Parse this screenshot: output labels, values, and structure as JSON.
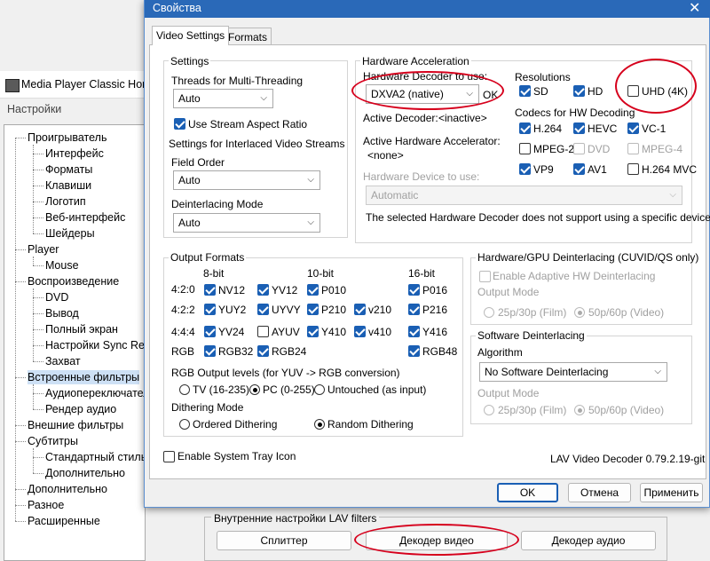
{
  "back_window": {
    "title": "Media Player Classic Hom",
    "subtitle": "Настройки",
    "tree": [
      {
        "label": "Проигрыватель",
        "level": 0
      },
      {
        "label": "Интерфейс",
        "level": 1
      },
      {
        "label": "Форматы",
        "level": 1
      },
      {
        "label": "Клавиши",
        "level": 1
      },
      {
        "label": "Логотип",
        "level": 1
      },
      {
        "label": "Веб-интерфейс",
        "level": 1
      },
      {
        "label": "Шейдеры",
        "level": 1
      },
      {
        "label": "Player",
        "level": 0
      },
      {
        "label": "Mouse",
        "level": 1
      },
      {
        "label": "Воспроизведение",
        "level": 0
      },
      {
        "label": "DVD",
        "level": 1
      },
      {
        "label": "Вывод",
        "level": 1
      },
      {
        "label": "Полный экран",
        "level": 1
      },
      {
        "label": "Настройки Sync Ren",
        "level": 1
      },
      {
        "label": "Захват",
        "level": 1
      },
      {
        "label": "Встроенные фильтры",
        "level": 0,
        "selected": true
      },
      {
        "label": "Аудиопереключател",
        "level": 1
      },
      {
        "label": "Рендер аудио",
        "level": 1
      },
      {
        "label": "Внешние фильтры",
        "level": 0
      },
      {
        "label": "Субтитры",
        "level": 0
      },
      {
        "label": "Стандартный стиль",
        "level": 1
      },
      {
        "label": "Дополнительно",
        "level": 1
      },
      {
        "label": "Дополнительно",
        "level": 0
      },
      {
        "label": "Разное",
        "level": 0
      },
      {
        "label": "Расширенные",
        "level": 0
      }
    ],
    "lav_group_label": "Внутренние настройки LAV filters",
    "splitter_button": "Сплиттер",
    "video_decoder_button": "Декодер видео",
    "audio_decoder_button": "Декодер аудио"
  },
  "dialog": {
    "title": "Свойства",
    "close": "✕",
    "tabs": [
      "Video Settings",
      "Formats"
    ],
    "settings": {
      "label": "Settings",
      "threads_label": "Threads for Multi-Threading",
      "threads_value": "Auto",
      "stream_aspect": "Use Stream Aspect Ratio",
      "interlaced_label": "Settings for Interlaced Video Streams",
      "field_order_label": "Field Order",
      "field_order_value": "Auto",
      "deinterlacing_mode_label": "Deinterlacing Mode",
      "deinterlacing_mode_value": "Auto"
    },
    "hw": {
      "label": "Hardware Acceleration",
      "decoder_label": "Hardware Decoder to use:",
      "decoder_value": "DXVA2 (native)",
      "ok": "OK",
      "active_decoder_label": "Active Decoder:",
      "active_decoder_value": "<inactive>",
      "active_accel_label": "Active Hardware Accelerator:",
      "active_accel_value": "<none>",
      "device_label": "Hardware Device to use:",
      "device_value": "Automatic",
      "note": "The selected Hardware Decoder does not support using a specific device.",
      "resolutions_label": "Resolutions",
      "res": [
        "SD",
        "HD",
        "UHD (4K)"
      ],
      "codecs_label": "Codecs for HW Decoding",
      "codecs": [
        "H.264",
        "HEVC",
        "VC-1",
        "MPEG-2",
        "DVD",
        "MPEG-4",
        "VP9",
        "AV1",
        "H.264 MVC"
      ]
    },
    "output": {
      "label": "Output Formats",
      "bits": [
        "8-bit",
        "10-bit",
        "16-bit"
      ],
      "rows": [
        "4:2:0",
        "4:2:2",
        "4:4:4",
        "RGB"
      ],
      "formats": [
        "NV12",
        "YV12",
        "P010",
        "P016",
        "YUY2",
        "UYVY",
        "P210",
        "v210",
        "P216",
        "YV24",
        "AYUV",
        "Y410",
        "v410",
        "Y416",
        "RGB32",
        "RGB24",
        "RGB48"
      ],
      "rgb_levels_label": "RGB Output levels (for YUV -> RGB conversion)",
      "tv": "TV (16-235)",
      "pc": "PC (0-255)",
      "untouched": "Untouched (as input)",
      "dithering_label": "Dithering Mode",
      "ordered": "Ordered Dithering",
      "random": "Random Dithering"
    },
    "gpu_deint": {
      "label": "Hardware/GPU Deinterlacing (CUVID/QS only)",
      "adaptive": "Enable Adaptive HW Deinterlacing",
      "output_mode": "Output Mode",
      "film": "25p/30p (Film)",
      "video": "50p/60p (Video)"
    },
    "sw_deint": {
      "label": "Software Deinterlacing",
      "algorithm_label": "Algorithm",
      "algorithm_value": "No Software Deinterlacing",
      "output_mode": "Output Mode",
      "film": "25p/30p (Film)",
      "video": "50p/60p (Video)"
    },
    "tray": "Enable System Tray Icon",
    "version": "LAV Video Decoder 0.79.2.19-git",
    "ok_button": "OK",
    "cancel_button": "Отмена",
    "apply_button": "Применить"
  }
}
